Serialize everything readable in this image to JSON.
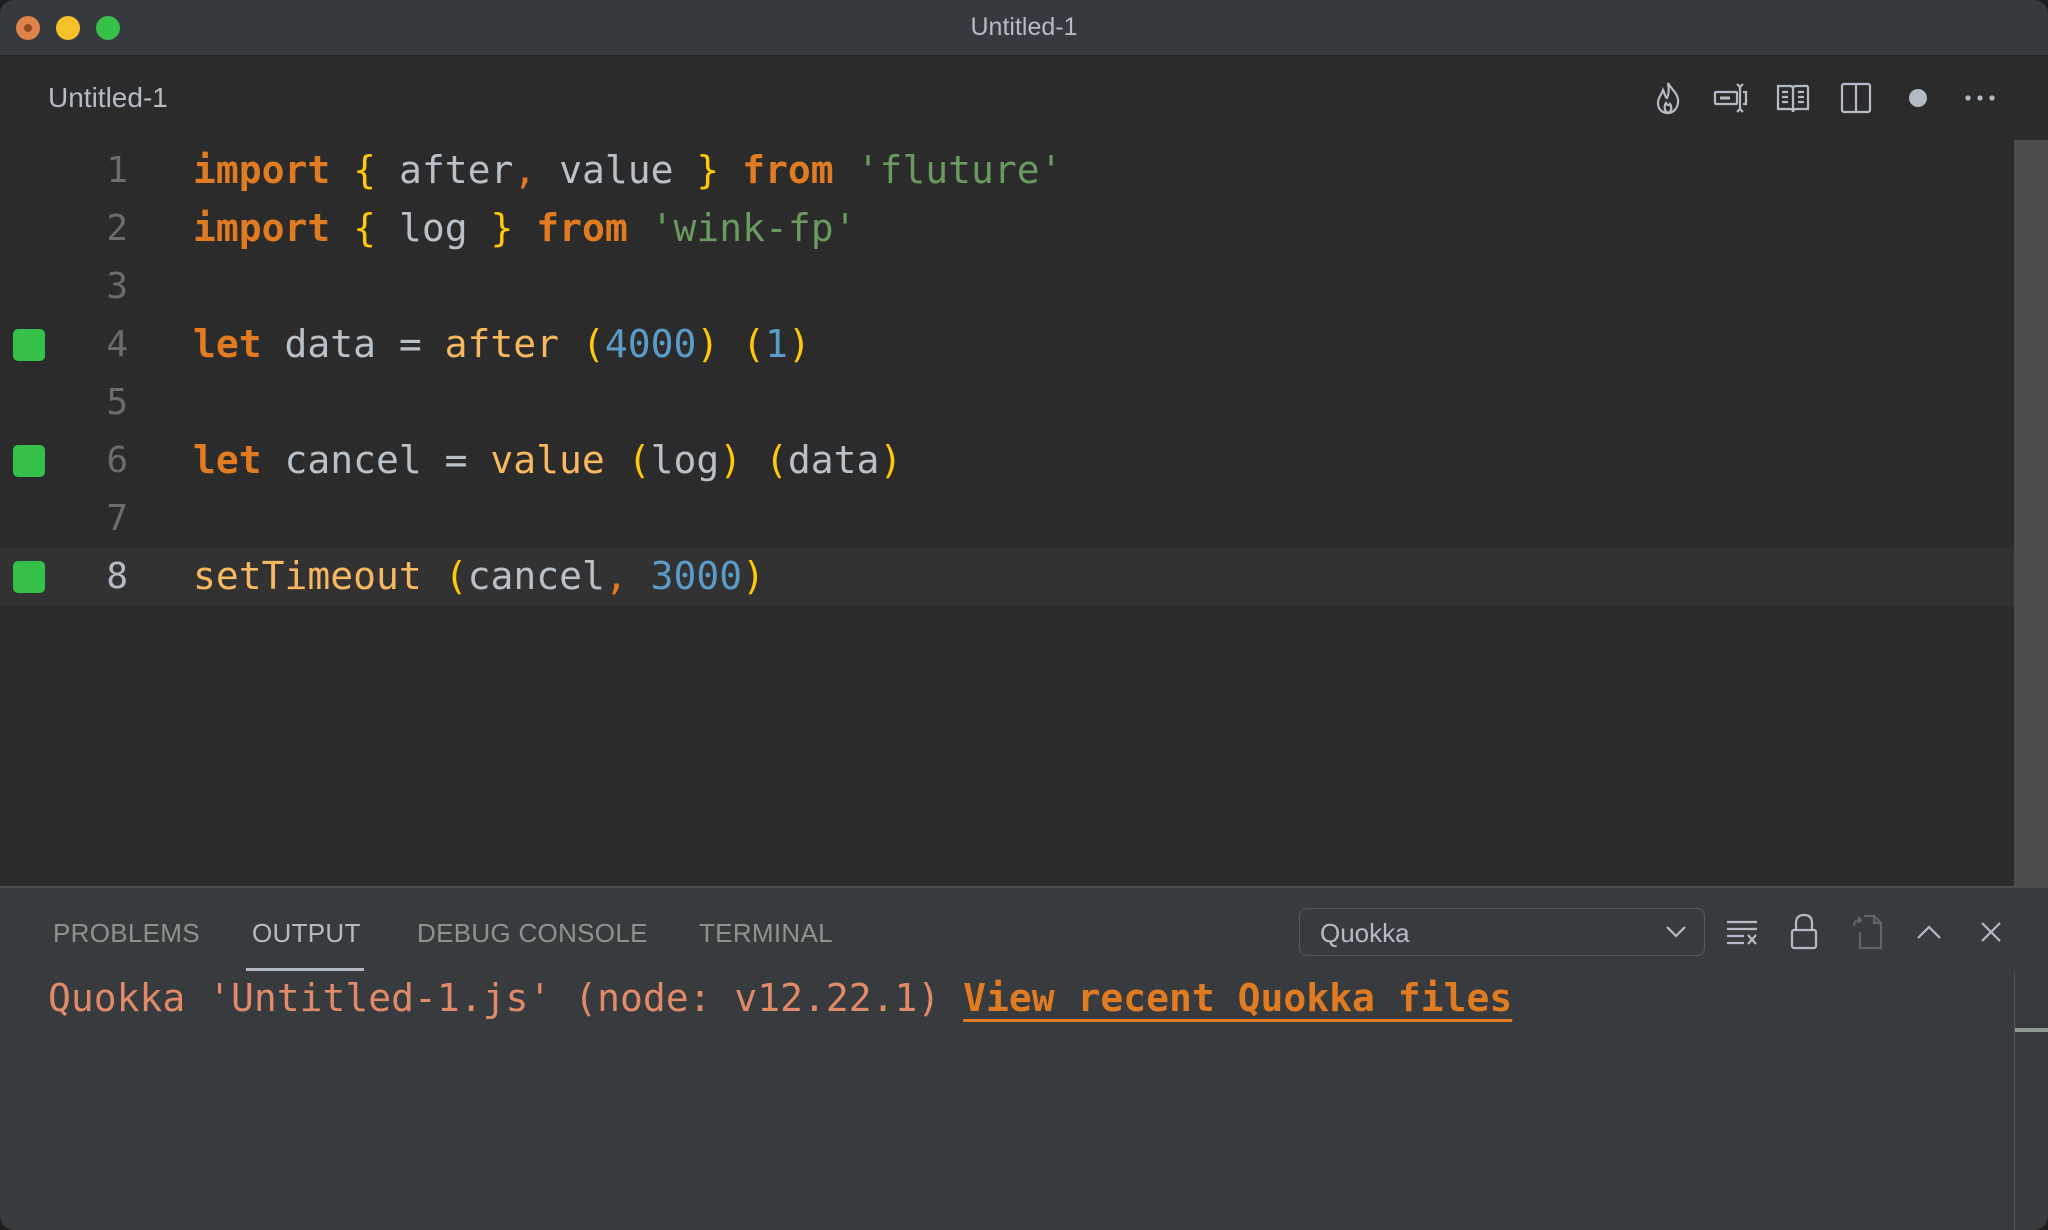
{
  "window": {
    "title": "Untitled-1"
  },
  "editor_tab": {
    "label": "Untitled-1",
    "actions": [
      {
        "name": "quokka-flame-icon"
      },
      {
        "name": "rename-symbol-icon"
      },
      {
        "name": "open-preview-icon"
      },
      {
        "name": "split-editor-icon"
      },
      {
        "name": "unsaved-dot-icon"
      },
      {
        "name": "more-actions-icon"
      }
    ]
  },
  "code_lines": [
    {
      "number": "1",
      "marker": false,
      "tokens": [
        {
          "t": "import",
          "c": "kw"
        },
        {
          "t": " ",
          "c": ""
        },
        {
          "t": "{",
          "c": "br"
        },
        {
          "t": " after",
          "c": ""
        },
        {
          "t": ",",
          "c": "punc"
        },
        {
          "t": " value ",
          "c": ""
        },
        {
          "t": "}",
          "c": "br"
        },
        {
          "t": " ",
          "c": ""
        },
        {
          "t": "from",
          "c": "kw"
        },
        {
          "t": " ",
          "c": ""
        },
        {
          "t": "'fluture'",
          "c": "str"
        }
      ]
    },
    {
      "number": "2",
      "marker": false,
      "tokens": [
        {
          "t": "import",
          "c": "kw"
        },
        {
          "t": " ",
          "c": ""
        },
        {
          "t": "{",
          "c": "br"
        },
        {
          "t": " log ",
          "c": ""
        },
        {
          "t": "}",
          "c": "br"
        },
        {
          "t": " ",
          "c": ""
        },
        {
          "t": "from",
          "c": "kw"
        },
        {
          "t": " ",
          "c": ""
        },
        {
          "t": "'wink-fp'",
          "c": "str"
        }
      ]
    },
    {
      "number": "3",
      "marker": false,
      "tokens": []
    },
    {
      "number": "4",
      "marker": true,
      "tokens": [
        {
          "t": "let",
          "c": "kw"
        },
        {
          "t": " data = ",
          "c": ""
        },
        {
          "t": "after",
          "c": "fn"
        },
        {
          "t": " ",
          "c": ""
        },
        {
          "t": "(",
          "c": "br"
        },
        {
          "t": "4000",
          "c": "num"
        },
        {
          "t": ")",
          "c": "br"
        },
        {
          "t": " ",
          "c": ""
        },
        {
          "t": "(",
          "c": "br"
        },
        {
          "t": "1",
          "c": "num"
        },
        {
          "t": ")",
          "c": "br"
        }
      ]
    },
    {
      "number": "5",
      "marker": false,
      "tokens": []
    },
    {
      "number": "6",
      "marker": true,
      "tokens": [
        {
          "t": "let",
          "c": "kw"
        },
        {
          "t": " cancel = ",
          "c": ""
        },
        {
          "t": "value",
          "c": "fn"
        },
        {
          "t": " ",
          "c": ""
        },
        {
          "t": "(",
          "c": "br"
        },
        {
          "t": "log",
          "c": ""
        },
        {
          "t": ")",
          "c": "br"
        },
        {
          "t": " ",
          "c": ""
        },
        {
          "t": "(",
          "c": "br"
        },
        {
          "t": "data",
          "c": ""
        },
        {
          "t": ")",
          "c": "br"
        }
      ]
    },
    {
      "number": "7",
      "marker": false,
      "tokens": []
    },
    {
      "number": "8",
      "marker": true,
      "current": true,
      "tokens": [
        {
          "t": "setTimeout",
          "c": "fn"
        },
        {
          "t": " ",
          "c": ""
        },
        {
          "t": "(",
          "c": "br"
        },
        {
          "t": "cancel",
          "c": ""
        },
        {
          "t": ",",
          "c": "punc"
        },
        {
          "t": " ",
          "c": ""
        },
        {
          "t": "3000",
          "c": "num"
        },
        {
          "t": ")",
          "c": "br"
        }
      ]
    }
  ],
  "panel": {
    "tabs": [
      {
        "label": "PROBLEMS",
        "active": false
      },
      {
        "label": "OUTPUT",
        "active": true
      },
      {
        "label": "DEBUG CONSOLE",
        "active": false
      },
      {
        "label": "TERMINAL",
        "active": false
      }
    ],
    "output_channel": "Quokka",
    "actions": [
      {
        "name": "clear-output-icon"
      },
      {
        "name": "lock-scroll-icon"
      },
      {
        "name": "open-log-file-icon"
      },
      {
        "name": "maximize-panel-icon"
      },
      {
        "name": "close-panel-icon"
      }
    ],
    "output_text": "Quokka 'Untitled-1.js' (node: v12.22.1) ",
    "output_link": "View recent Quokka files"
  },
  "colors": {
    "keyword": "#e07b22",
    "string": "#6a9a5f",
    "number": "#5b9bc8",
    "function": "#f8b860",
    "bracket": "#ffc80a",
    "marker_green": "#35c04a",
    "output_text": "#e08a6a",
    "output_link": "#e07b22"
  }
}
